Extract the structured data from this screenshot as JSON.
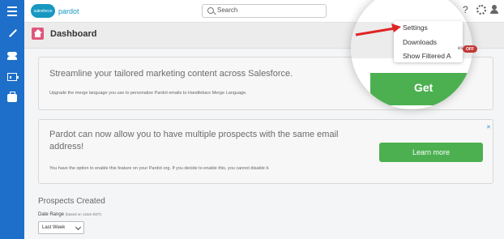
{
  "header": {
    "logo_text": "salesforce",
    "logo_subtext": "pardot",
    "search_placeholder": "Search",
    "help_glyph": "?"
  },
  "page": {
    "title": "Dashboard"
  },
  "cards": [
    {
      "title": "Streamline your tailored marketing content across Salesforce.",
      "description": "Upgrade the merge language you use to personalize Pardot emails to Handlebars Merge Language."
    },
    {
      "title": "Pardot can now allow you to have multiple prospects with the same email address!",
      "description": "You have the option to enable this feature on your Pardot org. If you decide to enable this, you cannot disable it.",
      "button_label": "Learn more",
      "close_glyph": "✕"
    }
  ],
  "prospects": {
    "title": "Prospects Created",
    "date_range_label": "Date Range",
    "date_range_note": "(based on 12am EDT)",
    "selected_range": "Last Week"
  },
  "settings_menu": {
    "items": [
      "Settings",
      "Downloads",
      "Show Filtered A"
    ],
    "truncated_row_text": "es",
    "toggle_label": "OFF"
  },
  "magnified": {
    "button_text_fragment": "Get"
  },
  "colors": {
    "brand_blue": "#1d6fc9",
    "accent_green": "#4cb050",
    "home_pink": "#e0577b",
    "arrow_red": "#e02424",
    "toggle_red": "#c23934"
  },
  "icons": [
    "menu-icon",
    "search-icon",
    "help-icon",
    "gear-icon",
    "user-icon",
    "wand-icon",
    "people-icon",
    "chart-icon",
    "briefcase-icon",
    "home-icon",
    "chevron-down-icon",
    "close-icon"
  ]
}
